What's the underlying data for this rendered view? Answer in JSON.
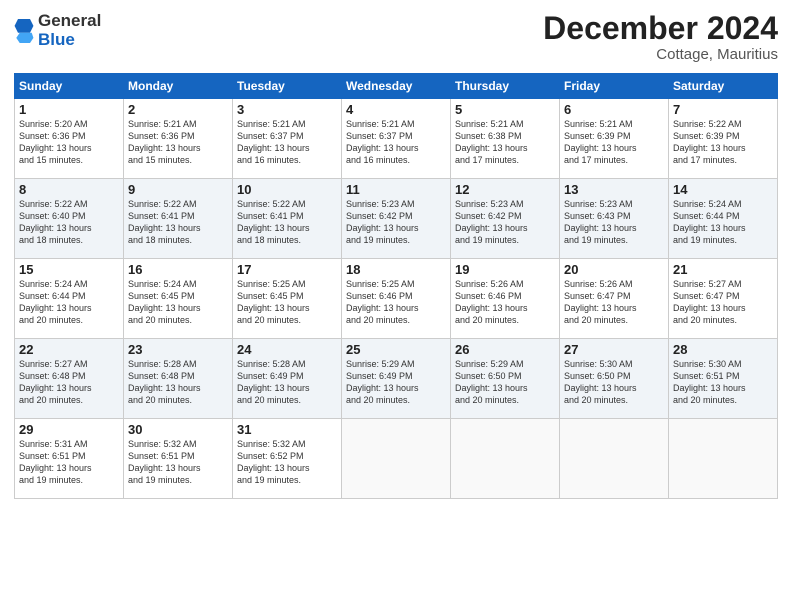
{
  "header": {
    "logo_general": "General",
    "logo_blue": "Blue",
    "month": "December 2024",
    "location": "Cottage, Mauritius"
  },
  "weekdays": [
    "Sunday",
    "Monday",
    "Tuesday",
    "Wednesday",
    "Thursday",
    "Friday",
    "Saturday"
  ],
  "weeks": [
    [
      {
        "day": "1",
        "lines": [
          "Sunrise: 5:20 AM",
          "Sunset: 6:36 PM",
          "Daylight: 13 hours",
          "and 15 minutes."
        ]
      },
      {
        "day": "2",
        "lines": [
          "Sunrise: 5:21 AM",
          "Sunset: 6:36 PM",
          "Daylight: 13 hours",
          "and 15 minutes."
        ]
      },
      {
        "day": "3",
        "lines": [
          "Sunrise: 5:21 AM",
          "Sunset: 6:37 PM",
          "Daylight: 13 hours",
          "and 16 minutes."
        ]
      },
      {
        "day": "4",
        "lines": [
          "Sunrise: 5:21 AM",
          "Sunset: 6:37 PM",
          "Daylight: 13 hours",
          "and 16 minutes."
        ]
      },
      {
        "day": "5",
        "lines": [
          "Sunrise: 5:21 AM",
          "Sunset: 6:38 PM",
          "Daylight: 13 hours",
          "and 17 minutes."
        ]
      },
      {
        "day": "6",
        "lines": [
          "Sunrise: 5:21 AM",
          "Sunset: 6:39 PM",
          "Daylight: 13 hours",
          "and 17 minutes."
        ]
      },
      {
        "day": "7",
        "lines": [
          "Sunrise: 5:22 AM",
          "Sunset: 6:39 PM",
          "Daylight: 13 hours",
          "and 17 minutes."
        ]
      }
    ],
    [
      {
        "day": "8",
        "lines": [
          "Sunrise: 5:22 AM",
          "Sunset: 6:40 PM",
          "Daylight: 13 hours",
          "and 18 minutes."
        ]
      },
      {
        "day": "9",
        "lines": [
          "Sunrise: 5:22 AM",
          "Sunset: 6:41 PM",
          "Daylight: 13 hours",
          "and 18 minutes."
        ]
      },
      {
        "day": "10",
        "lines": [
          "Sunrise: 5:22 AM",
          "Sunset: 6:41 PM",
          "Daylight: 13 hours",
          "and 18 minutes."
        ]
      },
      {
        "day": "11",
        "lines": [
          "Sunrise: 5:23 AM",
          "Sunset: 6:42 PM",
          "Daylight: 13 hours",
          "and 19 minutes."
        ]
      },
      {
        "day": "12",
        "lines": [
          "Sunrise: 5:23 AM",
          "Sunset: 6:42 PM",
          "Daylight: 13 hours",
          "and 19 minutes."
        ]
      },
      {
        "day": "13",
        "lines": [
          "Sunrise: 5:23 AM",
          "Sunset: 6:43 PM",
          "Daylight: 13 hours",
          "and 19 minutes."
        ]
      },
      {
        "day": "14",
        "lines": [
          "Sunrise: 5:24 AM",
          "Sunset: 6:44 PM",
          "Daylight: 13 hours",
          "and 19 minutes."
        ]
      }
    ],
    [
      {
        "day": "15",
        "lines": [
          "Sunrise: 5:24 AM",
          "Sunset: 6:44 PM",
          "Daylight: 13 hours",
          "and 20 minutes."
        ]
      },
      {
        "day": "16",
        "lines": [
          "Sunrise: 5:24 AM",
          "Sunset: 6:45 PM",
          "Daylight: 13 hours",
          "and 20 minutes."
        ]
      },
      {
        "day": "17",
        "lines": [
          "Sunrise: 5:25 AM",
          "Sunset: 6:45 PM",
          "Daylight: 13 hours",
          "and 20 minutes."
        ]
      },
      {
        "day": "18",
        "lines": [
          "Sunrise: 5:25 AM",
          "Sunset: 6:46 PM",
          "Daylight: 13 hours",
          "and 20 minutes."
        ]
      },
      {
        "day": "19",
        "lines": [
          "Sunrise: 5:26 AM",
          "Sunset: 6:46 PM",
          "Daylight: 13 hours",
          "and 20 minutes."
        ]
      },
      {
        "day": "20",
        "lines": [
          "Sunrise: 5:26 AM",
          "Sunset: 6:47 PM",
          "Daylight: 13 hours",
          "and 20 minutes."
        ]
      },
      {
        "day": "21",
        "lines": [
          "Sunrise: 5:27 AM",
          "Sunset: 6:47 PM",
          "Daylight: 13 hours",
          "and 20 minutes."
        ]
      }
    ],
    [
      {
        "day": "22",
        "lines": [
          "Sunrise: 5:27 AM",
          "Sunset: 6:48 PM",
          "Daylight: 13 hours",
          "and 20 minutes."
        ]
      },
      {
        "day": "23",
        "lines": [
          "Sunrise: 5:28 AM",
          "Sunset: 6:48 PM",
          "Daylight: 13 hours",
          "and 20 minutes."
        ]
      },
      {
        "day": "24",
        "lines": [
          "Sunrise: 5:28 AM",
          "Sunset: 6:49 PM",
          "Daylight: 13 hours",
          "and 20 minutes."
        ]
      },
      {
        "day": "25",
        "lines": [
          "Sunrise: 5:29 AM",
          "Sunset: 6:49 PM",
          "Daylight: 13 hours",
          "and 20 minutes."
        ]
      },
      {
        "day": "26",
        "lines": [
          "Sunrise: 5:29 AM",
          "Sunset: 6:50 PM",
          "Daylight: 13 hours",
          "and 20 minutes."
        ]
      },
      {
        "day": "27",
        "lines": [
          "Sunrise: 5:30 AM",
          "Sunset: 6:50 PM",
          "Daylight: 13 hours",
          "and 20 minutes."
        ]
      },
      {
        "day": "28",
        "lines": [
          "Sunrise: 5:30 AM",
          "Sunset: 6:51 PM",
          "Daylight: 13 hours",
          "and 20 minutes."
        ]
      }
    ],
    [
      {
        "day": "29",
        "lines": [
          "Sunrise: 5:31 AM",
          "Sunset: 6:51 PM",
          "Daylight: 13 hours",
          "and 19 minutes."
        ]
      },
      {
        "day": "30",
        "lines": [
          "Sunrise: 5:32 AM",
          "Sunset: 6:51 PM",
          "Daylight: 13 hours",
          "and 19 minutes."
        ]
      },
      {
        "day": "31",
        "lines": [
          "Sunrise: 5:32 AM",
          "Sunset: 6:52 PM",
          "Daylight: 13 hours",
          "and 19 minutes."
        ]
      },
      null,
      null,
      null,
      null
    ]
  ]
}
